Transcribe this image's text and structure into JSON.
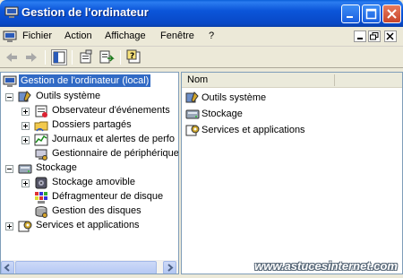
{
  "window": {
    "title": "Gestion de l'ordinateur"
  },
  "menu": {
    "items": [
      "Fichier",
      "Action",
      "Affichage",
      "Fenêtre",
      "?"
    ]
  },
  "tree": {
    "root": "Gestion de l'ordinateur (local)",
    "nodes": [
      {
        "label": "Outils système",
        "icon": "tools-icon",
        "level": 1,
        "expander": "minus"
      },
      {
        "label": "Observateur d'événements",
        "icon": "event-viewer-icon",
        "level": 2,
        "expander": "plus"
      },
      {
        "label": "Dossiers partagés",
        "icon": "shared-folder-icon",
        "level": 2,
        "expander": "plus"
      },
      {
        "label": "Journaux et alertes de perfo",
        "icon": "performance-logs-icon",
        "level": 2,
        "expander": "plus"
      },
      {
        "label": "Gestionnaire de périphérique",
        "icon": "device-manager-icon",
        "level": 2,
        "expander": "none"
      },
      {
        "label": "Stockage",
        "icon": "storage-icon",
        "level": 1,
        "expander": "minus"
      },
      {
        "label": "Stockage amovible",
        "icon": "removable-storage-icon",
        "level": 2,
        "expander": "plus"
      },
      {
        "label": "Défragmenteur de disque",
        "icon": "defrag-icon",
        "level": 2,
        "expander": "none"
      },
      {
        "label": "Gestion des disques",
        "icon": "disk-management-icon",
        "level": 2,
        "expander": "none"
      },
      {
        "label": "Services et applications",
        "icon": "services-icon",
        "level": 1,
        "expander": "plus"
      }
    ]
  },
  "list": {
    "column_header": "Nom",
    "items": [
      "Outils système",
      "Stockage",
      "Services et applications"
    ]
  },
  "watermark": "www.astucesinternet.com"
}
